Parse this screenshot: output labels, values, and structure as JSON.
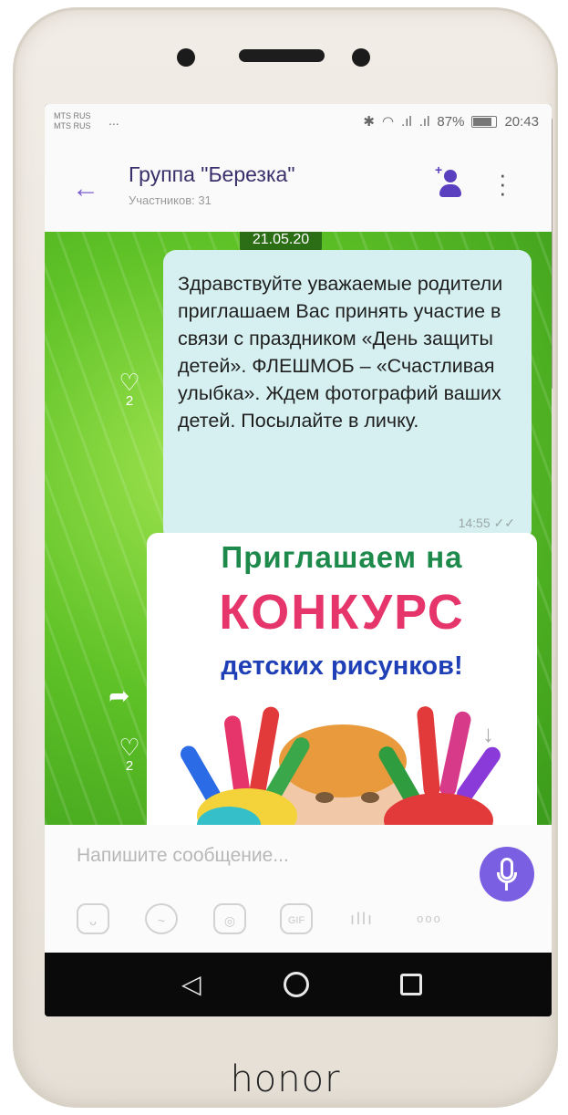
{
  "device": {
    "brand": "honor"
  },
  "status_bar": {
    "carrier_1": "MTS RUS",
    "carrier_2": "MTS RUS",
    "carrier_dots": "...",
    "battery": "87%",
    "time": "20:43"
  },
  "app_bar": {
    "title": "Группа \"Березка\"",
    "subtitle": "Участников: 31",
    "back_icon": "arrow-left-icon",
    "add_member_icon": "add-member-icon",
    "menu_icon": "more-vertical-icon"
  },
  "chat": {
    "date": "21.05.20",
    "message": {
      "text": "Здравствуйте уважаемые родители приглашаем Вас принять участие в связи с праздником «День защиты детей». ФЛЕШМОБ – «Счастливая улыбка». Ждем фотографий ваших детей. Посылайте в личку.",
      "time": "14:55",
      "likes": "2"
    },
    "image_message": {
      "line1": "Приглашаем на",
      "line2": "КОНКУРС",
      "line3": "детских рисунков!",
      "likes": "2"
    }
  },
  "composer": {
    "placeholder": "Напишите сообщение...",
    "tools": [
      "sticker-icon",
      "image-icon",
      "camera-icon",
      "gif-icon",
      "audio-wave-icon",
      "more-dots-icon"
    ],
    "gif_label": "GIF",
    "more_label": "ooo"
  },
  "nav_bar": {
    "back_icon": "nav-back-icon",
    "home_icon": "nav-home-icon",
    "recent_icon": "nav-recent-icon"
  },
  "colors": {
    "accent": "#7b5fe3",
    "chat_bg": "#5fc227",
    "bubble": "#d6f0f1"
  }
}
